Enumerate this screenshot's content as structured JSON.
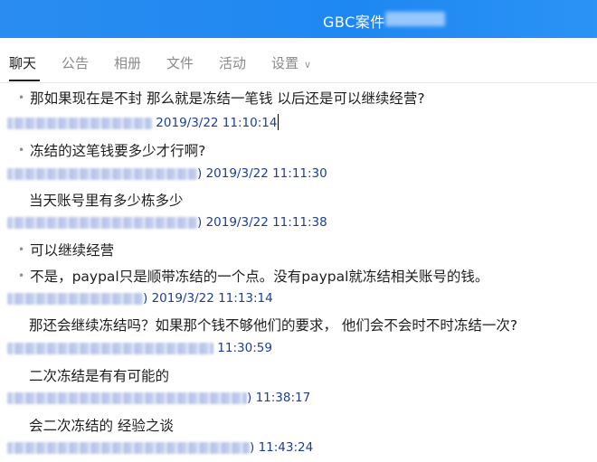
{
  "window": {
    "title": "GBC案件"
  },
  "tabs": [
    {
      "label": "聊天",
      "active": true
    },
    {
      "label": "公告"
    },
    {
      "label": "相册"
    },
    {
      "label": "文件"
    },
    {
      "label": "活动"
    },
    {
      "label": "设置",
      "has_dropdown": true
    }
  ],
  "messages": [
    {
      "text": "那如果现在是不封 那么就是冻结一笔钱 以后还是可以继续经营?",
      "bullet": true
    },
    {
      "meta": "2019/3/22 11:10:14",
      "meta_paren": ""
    },
    {
      "text": "冻结的这笔钱要多少才行啊?",
      "bullet": true
    },
    {
      "meta": "2019/3/22 11:11:30",
      "meta_paren": ")"
    },
    {
      "text": "当天账号里有多少栋多少",
      "bullet": false
    },
    {
      "meta": "2019/3/22 11:11:38",
      "meta_paren": ")"
    },
    {
      "text": "可以继续经营",
      "bullet": true
    },
    {
      "text": "不是，paypal只是顺带冻结的一个点。没有paypal就冻结相关账号的钱。",
      "bullet": true
    },
    {
      "meta": "2019/3/22 11:13:14",
      "meta_paren": ")"
    },
    {
      "text": "那还会继续冻结吗？如果那个钱不够他们的要求， 他们会不会时不时冻结一次?",
      "bullet": false
    },
    {
      "meta": "11:30:59",
      "meta_paren": ""
    },
    {
      "text": "二次冻结是有有可能的",
      "bullet": false
    },
    {
      "meta": "11:38:17",
      "meta_paren": ")"
    },
    {
      "text": "会二次冻结的 经验之谈",
      "bullet": false
    },
    {
      "meta": "11:43:24",
      "meta_paren": ")"
    }
  ],
  "colors": {
    "titlebar": "#1e88f2",
    "meta_text": "#1d3e96",
    "message_text": "#1d1d1d"
  }
}
